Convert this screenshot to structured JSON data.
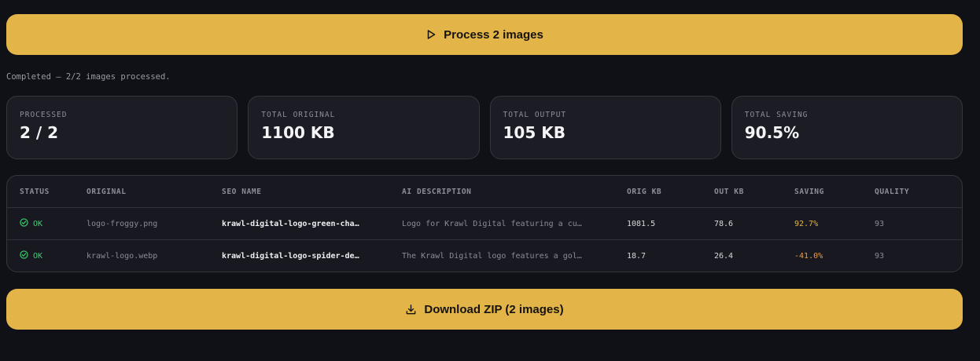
{
  "process_button": {
    "label": "Process 2 images",
    "icon": "play-icon"
  },
  "status_text": "Completed — 2/2 images processed.",
  "stats": [
    {
      "label": "PROCESSED",
      "value": "2 / 2"
    },
    {
      "label": "TOTAL ORIGINAL",
      "value": "1100 KB"
    },
    {
      "label": "TOTAL OUTPUT",
      "value": "105 KB"
    },
    {
      "label": "TOTAL SAVING",
      "value": "90.5%"
    }
  ],
  "table": {
    "headers": {
      "status": "STATUS",
      "original": "ORIGINAL",
      "seo_name": "SEO NAME",
      "ai_description": "AI DESCRIPTION",
      "orig_kb": "ORIG KB",
      "out_kb": "OUT KB",
      "saving": "SAVING",
      "quality": "QUALITY"
    },
    "rows": [
      {
        "status": "OK",
        "original": "logo-froggy.png",
        "seo_name": "krawl-digital-logo-green-cha…",
        "ai_description": "Logo for Krawl Digital featuring a cu…",
        "orig_kb": "1081.5",
        "out_kb": "78.6",
        "saving": "92.7%",
        "quality": "93"
      },
      {
        "status": "OK",
        "original": "krawl-logo.webp",
        "seo_name": "krawl-digital-logo-spider-de…",
        "ai_description": "The Krawl Digital logo features a gol…",
        "orig_kb": "18.7",
        "out_kb": "26.4",
        "saving": "-41.0%",
        "quality": "93"
      }
    ]
  },
  "download_button": {
    "label": "Download ZIP (2 images)",
    "icon": "download-icon"
  },
  "colors": {
    "accent": "#e3b549",
    "background": "#101117",
    "card": "#1b1c24",
    "ok": "#3ecf6f",
    "negative_saving": "#ef9a3c"
  }
}
